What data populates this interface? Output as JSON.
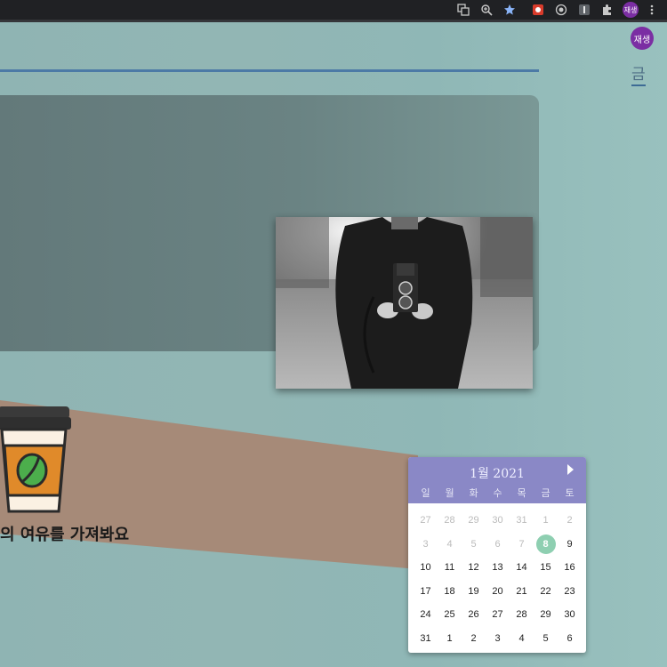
{
  "browser": {
    "profile_avatar": "재생",
    "icons": [
      "translate-icon",
      "zoom-icon",
      "bookmark-star-icon",
      "extension-red-icon",
      "record-icon",
      "info-icon",
      "puzzle-icon",
      "more-icon"
    ],
    "star_color": "#8ab4f8"
  },
  "header": {
    "user_avatar": "재생",
    "day_label": "금"
  },
  "slogan": "의 여유를 가져봐요",
  "calendar": {
    "title": "1월 2021",
    "weekdays": [
      "일",
      "월",
      "화",
      "수",
      "목",
      "금",
      "토"
    ],
    "weeks": [
      [
        {
          "d": "27",
          "m": true
        },
        {
          "d": "28",
          "m": true
        },
        {
          "d": "29",
          "m": true
        },
        {
          "d": "30",
          "m": true
        },
        {
          "d": "31",
          "m": true
        },
        {
          "d": "1",
          "m": true
        },
        {
          "d": "2",
          "m": true
        }
      ],
      [
        {
          "d": "3",
          "m": true
        },
        {
          "d": "4",
          "m": true
        },
        {
          "d": "5",
          "m": true
        },
        {
          "d": "6",
          "m": true
        },
        {
          "d": "7",
          "m": true
        },
        {
          "d": "8",
          "today": true
        },
        {
          "d": "9"
        }
      ],
      [
        {
          "d": "10"
        },
        {
          "d": "11"
        },
        {
          "d": "12"
        },
        {
          "d": "13"
        },
        {
          "d": "14"
        },
        {
          "d": "15"
        },
        {
          "d": "16"
        }
      ],
      [
        {
          "d": "17"
        },
        {
          "d": "18"
        },
        {
          "d": "19"
        },
        {
          "d": "20"
        },
        {
          "d": "21"
        },
        {
          "d": "22"
        },
        {
          "d": "23"
        }
      ],
      [
        {
          "d": "24"
        },
        {
          "d": "25"
        },
        {
          "d": "26"
        },
        {
          "d": "27"
        },
        {
          "d": "28"
        },
        {
          "d": "29"
        },
        {
          "d": "30"
        }
      ],
      [
        {
          "d": "31"
        },
        {
          "d": "1"
        },
        {
          "d": "2"
        },
        {
          "d": "3"
        },
        {
          "d": "4"
        },
        {
          "d": "5"
        },
        {
          "d": "6"
        }
      ]
    ],
    "header_color": "#8a88c6",
    "today_color": "#8ecfb1"
  },
  "colors": {
    "accent_rule": "#4c7aa6",
    "band": "#a68a78",
    "avatar": "#7b2ea3"
  }
}
